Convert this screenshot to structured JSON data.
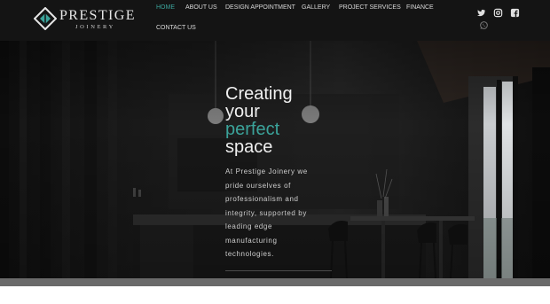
{
  "brand": {
    "name": "PRESTIGE",
    "sub": "JOINERY"
  },
  "nav": {
    "items": [
      {
        "label": "HOME",
        "active": true
      },
      {
        "label": "ABOUT US",
        "active": false
      },
      {
        "label": "DESIGN APPOINTMENT",
        "active": false
      },
      {
        "label": "GALLERY",
        "active": false
      },
      {
        "label": "PROJECT SERVICES",
        "active": false
      },
      {
        "label": "FINANCE",
        "active": false
      },
      {
        "label": "CONTACT US",
        "active": false
      }
    ]
  },
  "social": {
    "icons": [
      "twitter-icon",
      "instagram-icon",
      "facebook-icon",
      "whatsapp-icon"
    ]
  },
  "hero": {
    "line1": "Creating",
    "line2": "your",
    "line3": "perfect",
    "line4": "space",
    "paragraph": "At Prestige Joinery we pride ourselves of professionalism and integrity, supported by leading edge manufacturing technologies."
  },
  "colors": {
    "accent": "#3ba39a",
    "header_bg": "#141414"
  }
}
